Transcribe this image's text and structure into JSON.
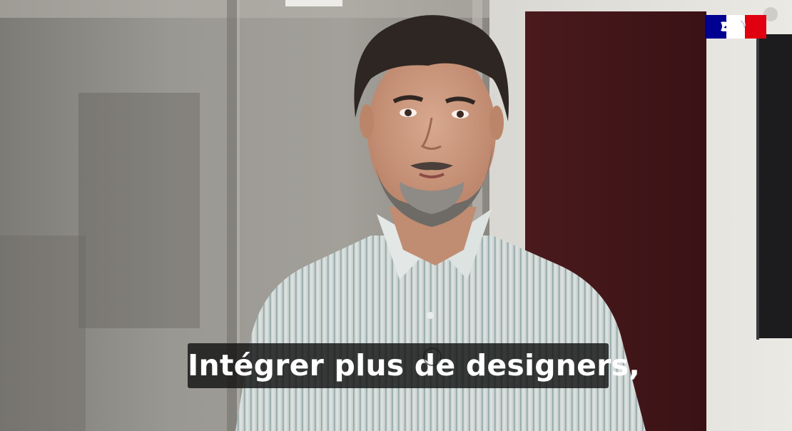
{
  "video": {
    "subtitle_text": "Intégrer plus de designers,",
    "logo_icon": "marianne-logo-icon",
    "colors": {
      "flag_blue": "#000091",
      "flag_red": "#e1000f",
      "subtitle_background": "#121212",
      "subtitle_text": "#ffffff"
    }
  }
}
